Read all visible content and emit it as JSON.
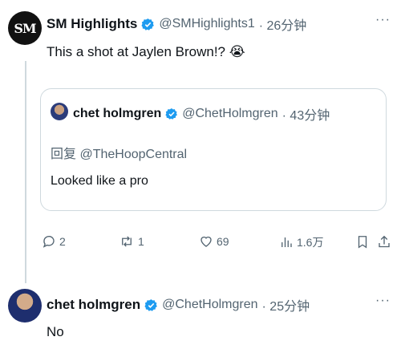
{
  "tweet1": {
    "name": "SM Highlights",
    "handle": "@SMHighlights1",
    "time": "· 26分钟",
    "text": "This a shot at Jaylen Brown!? 😭",
    "avatar_text": "SM",
    "more": "···"
  },
  "quote": {
    "name": "chet holmgren",
    "handle": "@ChetHolmgren",
    "time": "· 43分钟",
    "reply_to": "回复 @TheHoopCentral",
    "text": "Looked like a pro"
  },
  "actions": {
    "reply_count": "2",
    "retweet_count": "1",
    "like_count": "69",
    "views_count": "1.6万"
  },
  "tweet2": {
    "name": "chet holmgren",
    "handle": "@ChetHolmgren",
    "time": "· 25分钟",
    "text": "No",
    "more": "···"
  },
  "colors": {
    "verified": "#1d9bf0",
    "secondary_text": "#536471",
    "border": "#cfd9de"
  }
}
